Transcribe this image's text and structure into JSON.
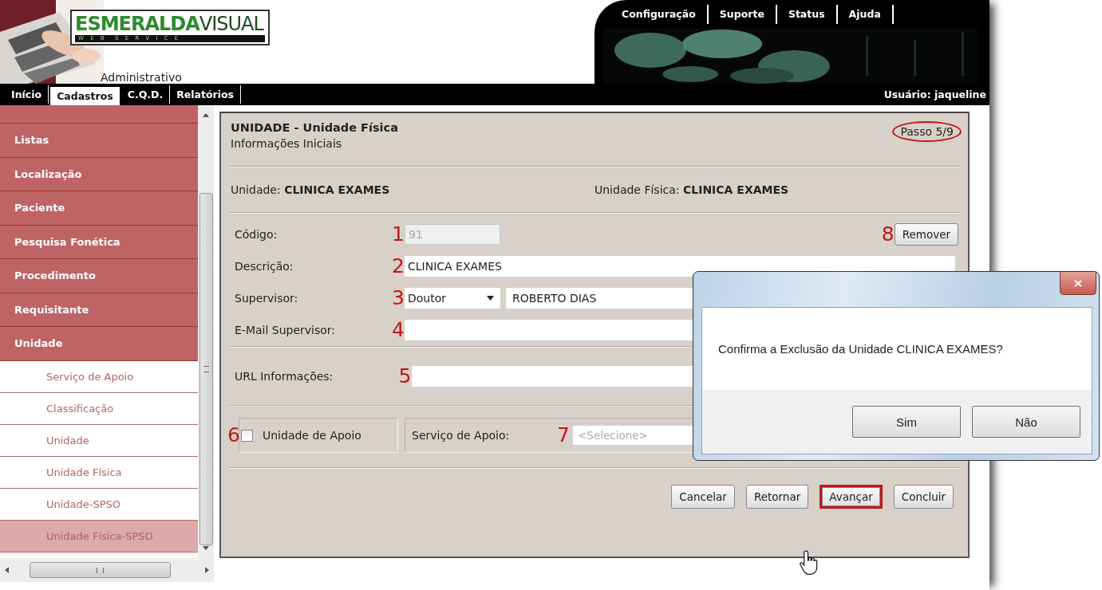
{
  "header": {
    "logo": {
      "name_bold": "ESMERALDA",
      "name_light": "VISUAL",
      "tagline": "W E B  S E R V I C E"
    },
    "module": "Administrativo",
    "top_links": [
      "Configuração",
      "Suporte",
      "Status",
      "Ajuda"
    ]
  },
  "nav": {
    "items": [
      {
        "label": "Início",
        "selected": false
      },
      {
        "label": "Cadastros",
        "selected": true
      },
      {
        "label": "C.Q.D.",
        "selected": false
      },
      {
        "label": "Relatórios",
        "selected": false
      }
    ],
    "user": "Usuário: jaqueline"
  },
  "sidebar": {
    "categories": [
      "Listas",
      "Localização",
      "Paciente",
      "Pesquisa Fonética",
      "Procedimento",
      "Requisitante",
      "Unidade"
    ],
    "subitems": [
      {
        "label": "Serviço de Apoio",
        "selected": false
      },
      {
        "label": "Classificação",
        "selected": false
      },
      {
        "label": "Unidade",
        "selected": false
      },
      {
        "label": "Unidade Física",
        "selected": false
      },
      {
        "label": "Unidade-SPSO",
        "selected": false
      },
      {
        "label": "Unidade Física-SPSO",
        "selected": true
      }
    ]
  },
  "panel": {
    "title": "UNIDADE - Unidade Física",
    "subtitle": "Informações Iniciais",
    "step": "Passo 5/9",
    "step_circled": true,
    "unit_label": "Unidade:",
    "unit_value": "CLINICA EXAMES",
    "physical_label": "Unidade Física:",
    "physical_value": "CLINICA EXAMES",
    "remove": {
      "marker": "8",
      "label": "Remover"
    },
    "fields": [
      {
        "marker": "1",
        "label": "Código:",
        "kind": "short",
        "value": "91",
        "disabled": true
      },
      {
        "marker": "2",
        "label": "Descrição:",
        "kind": "wide",
        "value": "CLINICA EXAMES",
        "disabled": false
      },
      {
        "marker": "3",
        "label": "Supervisor:",
        "kind": "select_text",
        "option": "Doutor",
        "value": "ROBERTO DIAS",
        "disabled": false
      },
      {
        "marker": "4",
        "label": "E-Mail Supervisor:",
        "kind": "wide",
        "disabled": false
      }
    ],
    "url_field": {
      "marker": "5",
      "label": "URL Informações:"
    },
    "support": {
      "marker": "6",
      "label": "Unidade de Apoio",
      "checked": false,
      "service_label": "Serviço de Apoio:",
      "service_marker": "7",
      "service_placeholder": "<Selecione>"
    },
    "buttons": [
      {
        "label": "Cancelar",
        "highlighted": false
      },
      {
        "label": "Retornar",
        "highlighted": false
      },
      {
        "label": "Avançar",
        "highlighted": true
      },
      {
        "label": "Concluir",
        "highlighted": false
      }
    ]
  },
  "dialog": {
    "message": "Confirma a Exclusão da Unidade CLINICA EXAMES?",
    "buttons": [
      "Sim",
      "Não"
    ]
  }
}
